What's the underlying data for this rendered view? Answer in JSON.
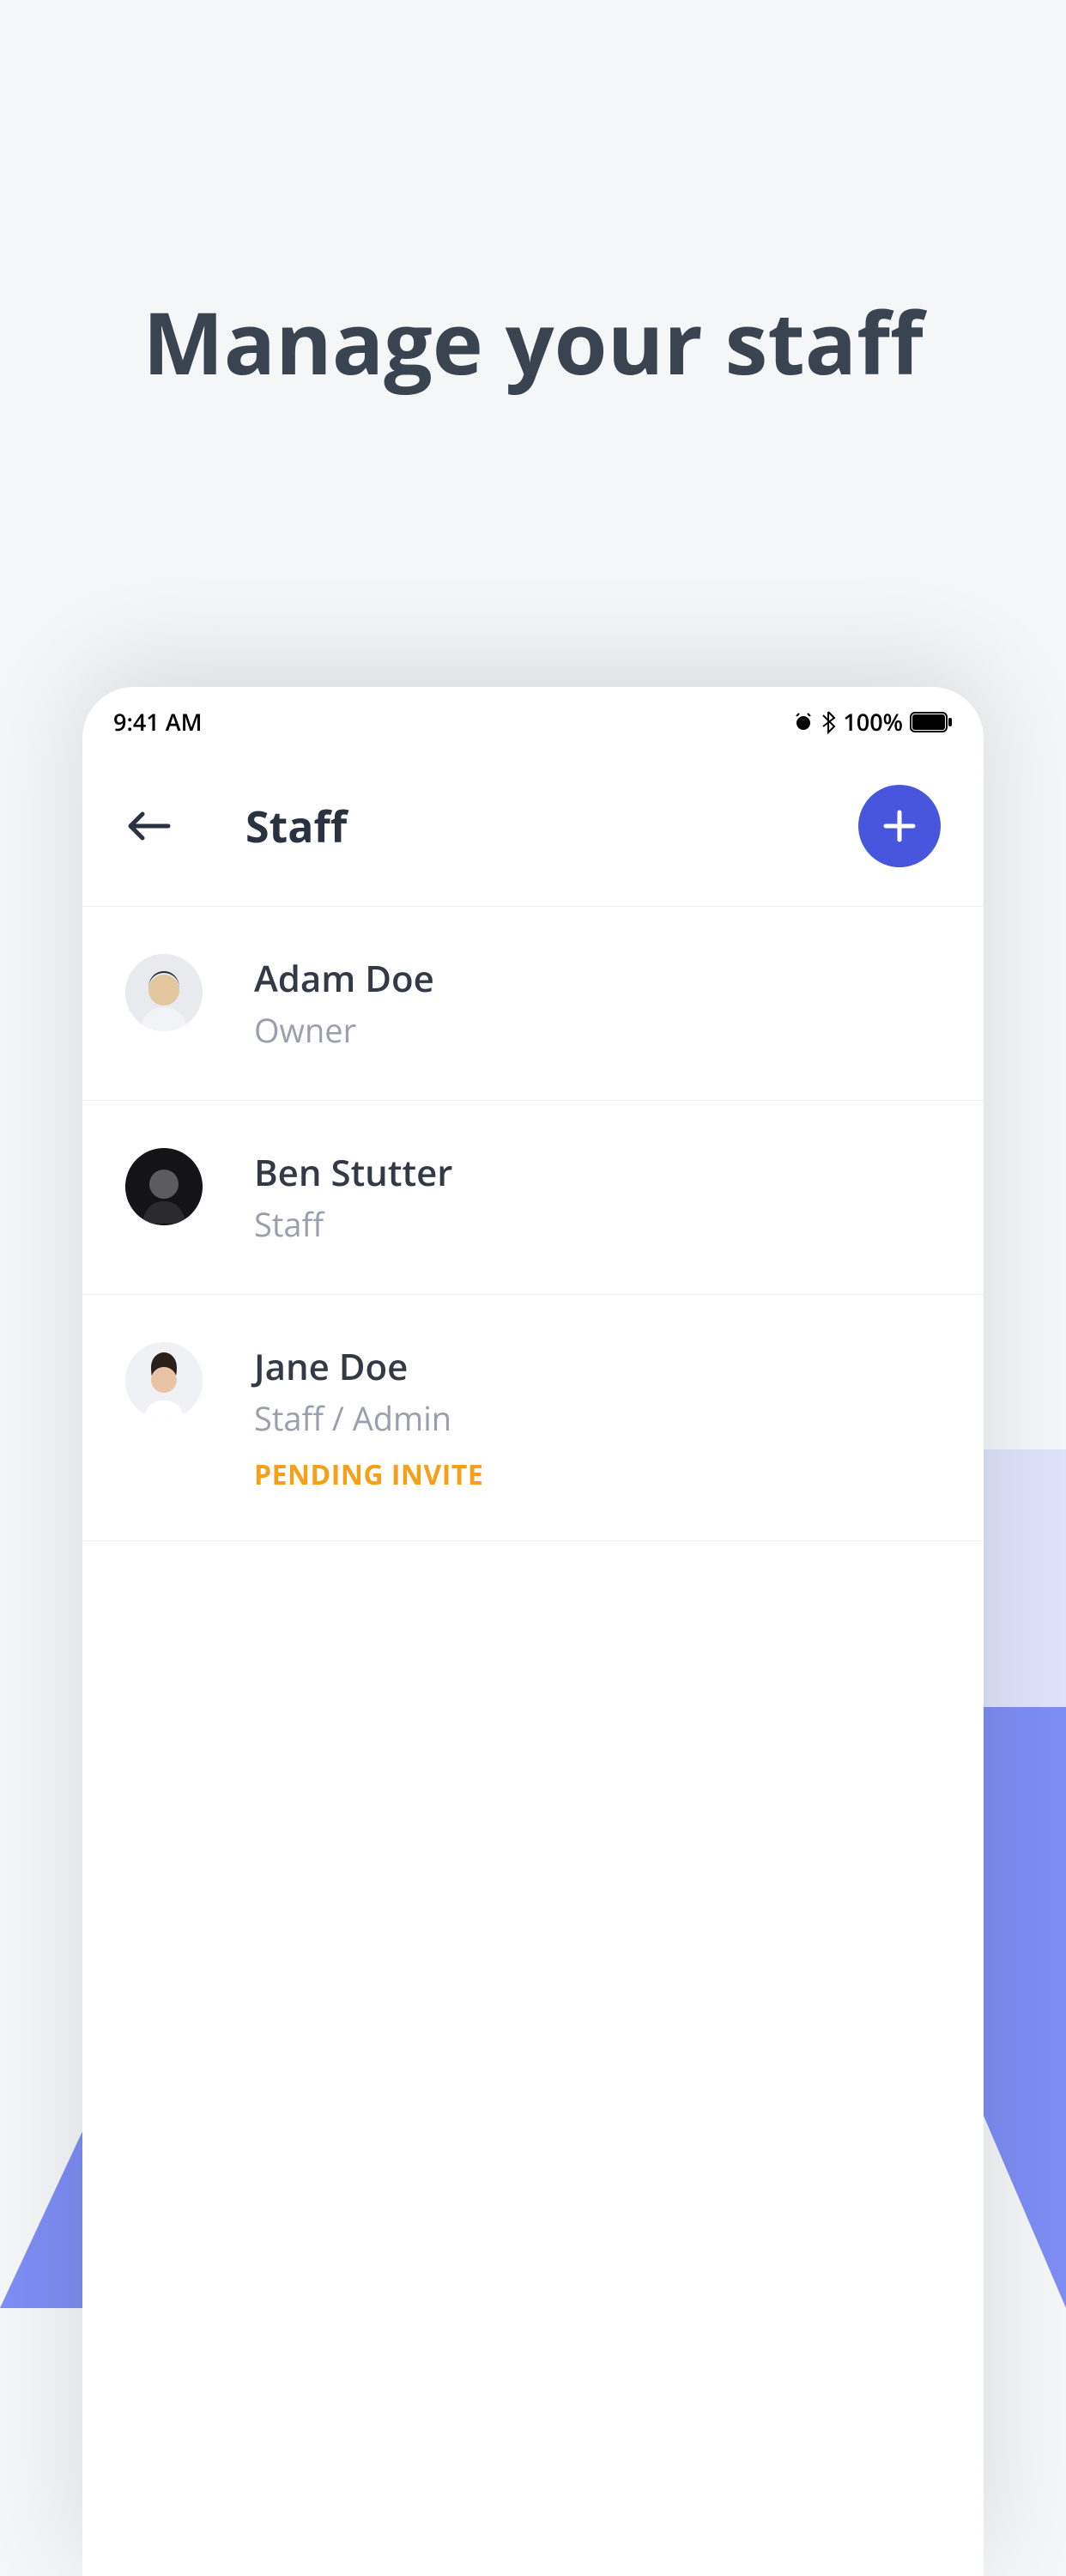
{
  "headline": "Manage your staff",
  "status_bar": {
    "time": "9:41 AM",
    "battery_pct": "100%"
  },
  "header": {
    "title": "Staff"
  },
  "staff": [
    {
      "name": "Adam Doe",
      "role": "Owner",
      "badge": null,
      "avatar_variant": "light-cap"
    },
    {
      "name": "Ben Stutter",
      "role": "Staff",
      "badge": null,
      "avatar_variant": "dark"
    },
    {
      "name": "Jane Doe",
      "role": "Staff / Admin",
      "badge": "PENDING INVITE",
      "avatar_variant": "light-face"
    }
  ],
  "colors": {
    "accent": "#4756dd",
    "badge": "#f6a01a"
  }
}
